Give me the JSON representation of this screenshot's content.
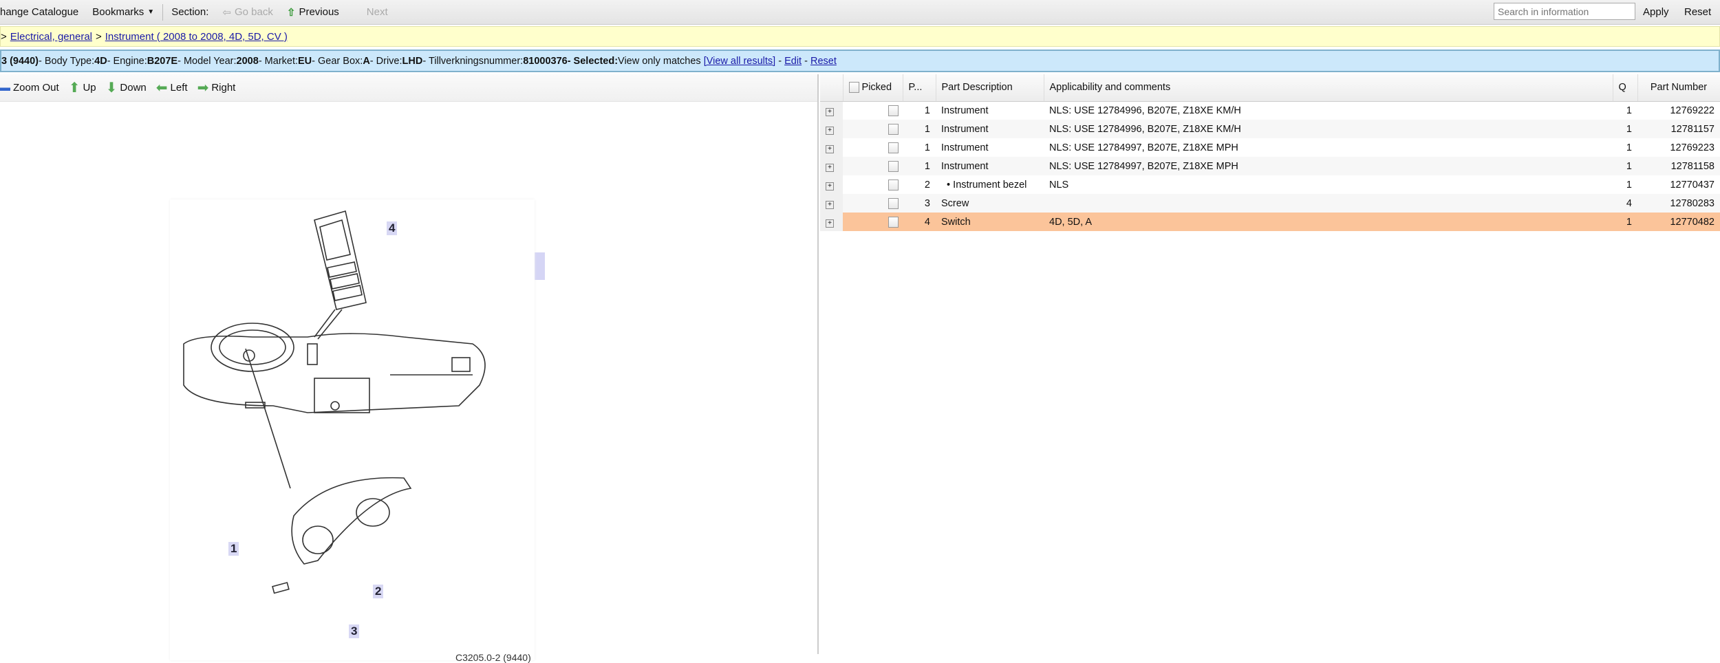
{
  "toolbar": {
    "change_catalogue": "hange Catalogue",
    "bookmarks": "Bookmarks",
    "section": "Section:",
    "go_back": "Go back",
    "previous": "Previous",
    "next": "Next",
    "search_placeholder": "Search in information",
    "apply": "Apply",
    "reset": "Reset"
  },
  "breadcrumb": {
    "sep": ">",
    "items": [
      "Electrical, general",
      "Instrument ( 2008 to 2008, 4D, 5D, CV )"
    ]
  },
  "info": {
    "model_tail": "3 (9440)",
    "body_type_label": " - Body Type: ",
    "body_type": "4D",
    "engine_label": " - Engine: ",
    "engine": "B207E",
    "model_year_label": " - Model Year: ",
    "model_year": "2008",
    "market_label": " - Market: ",
    "market": "EU",
    "gear_label": " - Gear Box: ",
    "gear": "A",
    "drive_label": " - Drive: ",
    "drive": "LHD",
    "tillv_label": " - Tillverkningsnummer: ",
    "tillv": "81000376",
    "selected_label": " - Selected: ",
    "selected": "View only matches ",
    "view_all": "[View all results]",
    "dash1": " - ",
    "edit": "Edit",
    "dash2": " - ",
    "reset": "Reset"
  },
  "nav": {
    "zoom_out": "Zoom Out",
    "up": "Up",
    "down": "Down",
    "left": "Left",
    "right": "Right"
  },
  "diagram": {
    "callouts": [
      "1",
      "2",
      "3",
      "4"
    ],
    "caption": "C3205.0-2 (9440)"
  },
  "table": {
    "headers": {
      "picked": "Picked",
      "pos": "P...",
      "desc": "Part Description",
      "app": "Applicability and comments",
      "q": "Q",
      "pn": "Part Number"
    },
    "rows": [
      {
        "pos": "1",
        "desc": "Instrument",
        "app": "NLS: USE 12784996, B207E, Z18XE KM/H",
        "q": "1",
        "pn": "12769222"
      },
      {
        "pos": "1",
        "desc": "Instrument",
        "app": "NLS: USE 12784996, B207E, Z18XE KM/H",
        "q": "1",
        "pn": "12781157"
      },
      {
        "pos": "1",
        "desc": "Instrument",
        "app": "NLS: USE 12784997, B207E, Z18XE MPH",
        "q": "1",
        "pn": "12769223"
      },
      {
        "pos": "1",
        "desc": "Instrument",
        "app": "NLS: USE 12784997, B207E, Z18XE MPH",
        "q": "1",
        "pn": "12781158"
      },
      {
        "pos": "2",
        "desc": "  • Instrument bezel",
        "app": "NLS",
        "q": "1",
        "pn": "12770437"
      },
      {
        "pos": "3",
        "desc": "Screw",
        "app": "",
        "q": "4",
        "pn": "12780283"
      },
      {
        "pos": "4",
        "desc": "Switch",
        "app": "4D, 5D, A",
        "q": "1",
        "pn": "12770482"
      }
    ]
  },
  "colors": {
    "selected_row": "#fbc49a",
    "info_bar": "#cce8fb",
    "breadcrumb_bar": "#ffffcc"
  }
}
